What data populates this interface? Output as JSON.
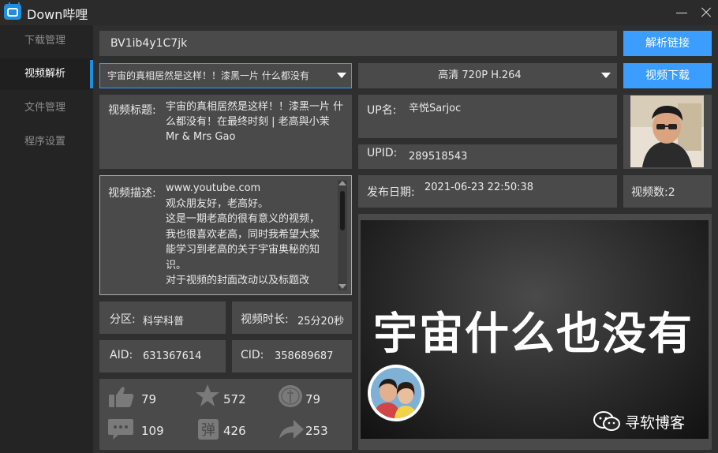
{
  "app": {
    "title": "Down哔哩"
  },
  "sidebar": {
    "items": [
      {
        "label": "下载管理"
      },
      {
        "label": "视频解析"
      },
      {
        "label": "文件管理"
      },
      {
        "label": "程序设置"
      }
    ],
    "active": "视频解析"
  },
  "search": {
    "value": "BV1ib4y1C7jk",
    "parse_label": "解析链接"
  },
  "video_select": {
    "value": "宇宙的真相居然是这样！！漆黑一片 什么都没有"
  },
  "quality_select": {
    "value": "高清 720P H.264"
  },
  "download_label": "视频下载",
  "info": {
    "title_label": "视频标题:",
    "title_value": "宇宙的真相居然是这样！！漆黑一片 什么都没有！在最终时刻 | 老高與小茉 Mr & Mrs Gao",
    "up_label": "UP名:",
    "up_value": "辛悦Sarjoc",
    "upid_label": "UPID:",
    "upid_value": "289518543",
    "desc_label": "视频描述:",
    "desc_lines": [
      "www.youtube.com",
      "观众朋友好，老高好。",
      "这是一期老高的很有意义的视频，",
      "我也很喜欢老高，同时我希望大家",
      "能学习到老高的关于宇宙奥秘的知",
      "识。",
      "对于视频的封面改动以及标题改"
    ],
    "date_label": "发布日期:",
    "date_value": "2021-06-23 22:50:38",
    "count_label": "视频数:2",
    "category_label": "分区:",
    "category_value": "科学科普",
    "duration_label": "视频时长:",
    "duration_value": "25分20秒",
    "aid_label": "AID:",
    "aid_value": "631367614",
    "cid_label": "CID:",
    "cid_value": "358689687"
  },
  "stats": {
    "likes": "79",
    "favorites": "572",
    "coins": "79",
    "comments": "109",
    "danmaku": "426",
    "shares": "253"
  },
  "cover": {
    "text": "宇宙什么也没有",
    "watermark": "寻软博客"
  },
  "colors": {
    "accent": "#3a9dff",
    "panel": "#4a4a4a",
    "background": "#2f2f2f",
    "sidebar": "#242424"
  }
}
